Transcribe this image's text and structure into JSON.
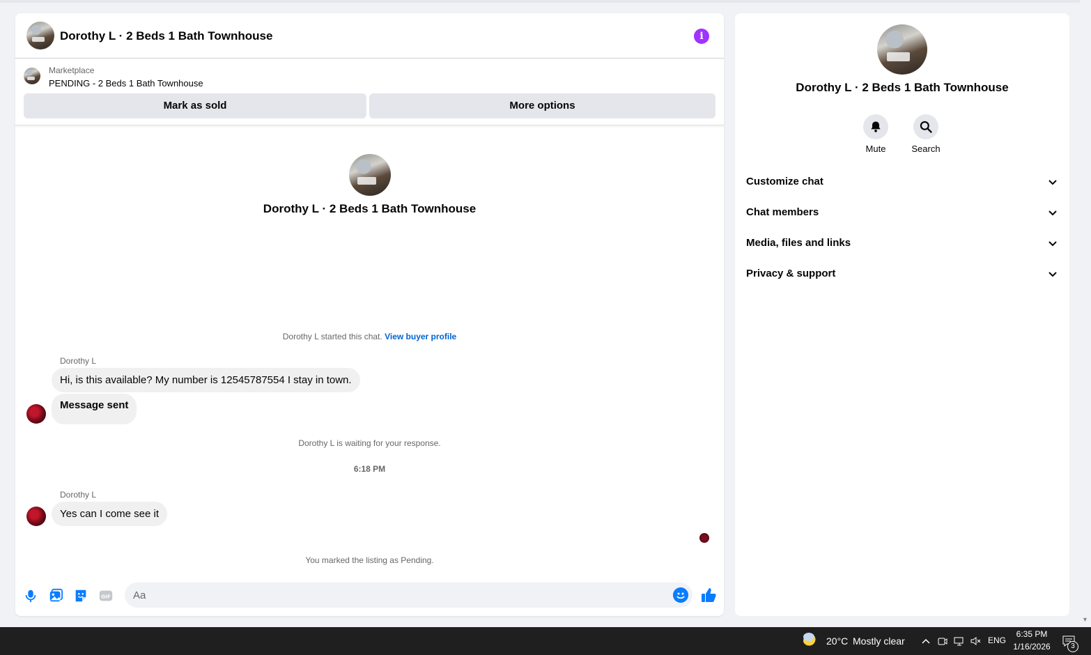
{
  "chat": {
    "title": "Dorothy L · 2 Beds 1 Bath Townhouse",
    "marketplace": {
      "source": "Marketplace",
      "status": "PENDING - 2 Beds 1 Bath Townhouse",
      "mark_sold_label": "Mark as sold",
      "more_options_label": "More options"
    },
    "intro_title": "Dorothy L · 2 Beds 1 Bath Townhouse",
    "started_text": "Dorothy L started this chat.",
    "view_buyer_link": "View buyer profile",
    "messages": [
      {
        "sender": "Dorothy L",
        "text": "Hi, is this available? My number is 12545787554 I stay in town."
      },
      {
        "text": "Message sent"
      },
      {
        "sender": "Dorothy L",
        "text": "Yes can I come see it"
      }
    ],
    "waiting_text": "Dorothy L is waiting for your response.",
    "timestamp": "6:18 PM",
    "pending_notice": "You marked the listing as Pending.",
    "composer": {
      "placeholder": "Aa",
      "icons": [
        "microphone-icon",
        "photo-icon",
        "sticker-icon",
        "gif-icon",
        "emoji-icon",
        "thumbs-up-icon"
      ],
      "gif_label": "GIF"
    }
  },
  "details": {
    "title": "Dorothy L · 2 Beds 1 Bath Townhouse",
    "actions": [
      {
        "label": "Mute",
        "icon": "bell-icon"
      },
      {
        "label": "Search",
        "icon": "search-icon"
      }
    ],
    "sections": [
      "Customize chat",
      "Chat members",
      "Media, files and links",
      "Privacy & support"
    ]
  },
  "taskbar": {
    "temperature": "20°C",
    "weather": "Mostly clear",
    "language": "ENG",
    "time": "6:35 PM",
    "date": "1/16/2026",
    "notifications": "3"
  },
  "colors": {
    "accent_blue": "#0a7cff",
    "info_purple": "#a033ff",
    "link_blue": "#0064d1",
    "bubble_bg": "#f0f0f0"
  }
}
